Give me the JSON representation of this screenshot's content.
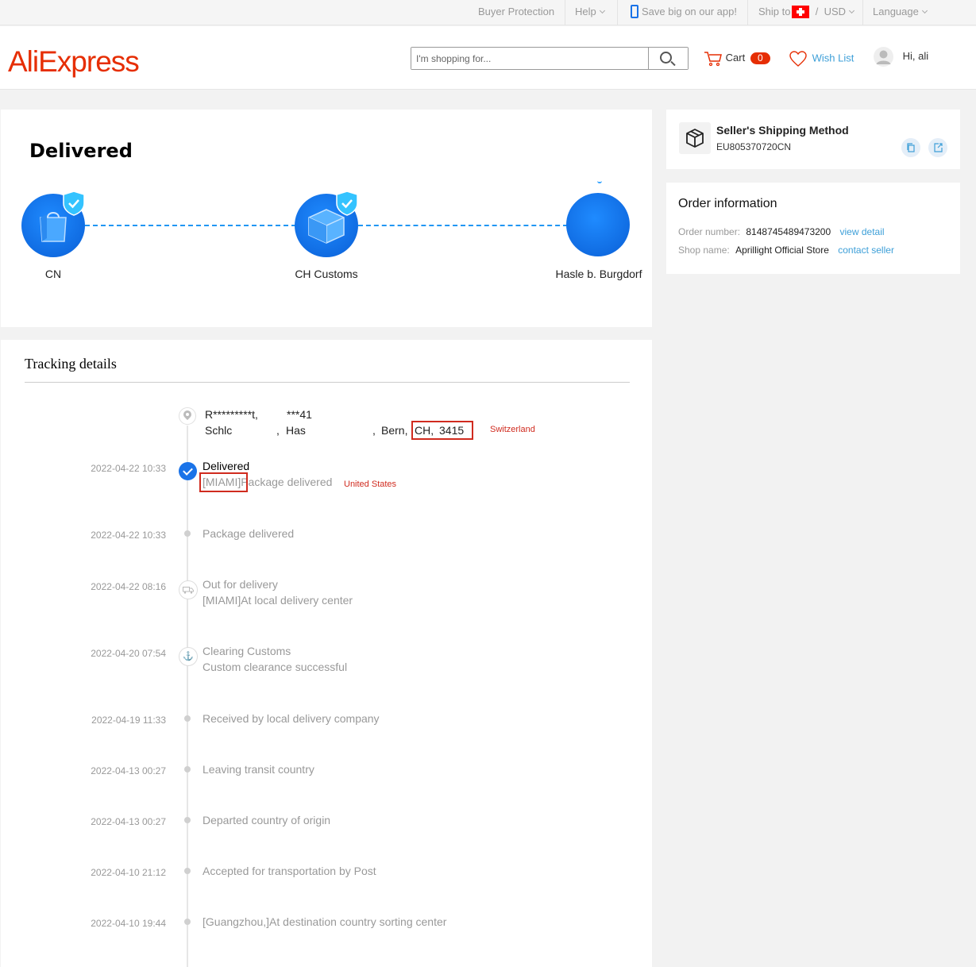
{
  "topbar": {
    "buyer_protection": "Buyer Protection",
    "help": "Help",
    "app_promo": "Save big on our app!",
    "ship_to": "Ship to",
    "currency_sep": "/",
    "currency": "USD",
    "language": "Language"
  },
  "header": {
    "logo": "AliExpress",
    "search_placeholder": "I'm shopping for...",
    "cart_label": "Cart",
    "cart_count": "0",
    "wishlist_label": "Wish List",
    "greeting": "Hi, ali"
  },
  "status": {
    "title": "Delivered",
    "nodes": [
      {
        "label": "CN",
        "icon": "shopping-bag-icon",
        "verified": true
      },
      {
        "label": "CH Customs",
        "icon": "customs-package-icon",
        "verified": true
      },
      {
        "label": "Hasle b. Burgdorf",
        "icon": "destination-icon",
        "verified": false
      }
    ]
  },
  "tracking": {
    "title": "Tracking details",
    "address_line1_name": "R*********t,",
    "address_line1_phone": "***41",
    "address_line2_street": "Schlc",
    "address_line2_sep1": ",",
    "address_line2_town": "Has",
    "address_line2_sep2": ",",
    "address_line2_city": "Bern,",
    "address_line2_country": "CH,",
    "address_line2_zip": "3415",
    "annotation_country": "Switzerland",
    "annotation_origin": "United States",
    "events": [
      {
        "time": "2022-04-22 10:33",
        "title": "Delivered",
        "subtitle": "[MIAMI]Package delivered",
        "marker": "check"
      },
      {
        "time": "2022-04-22 10:33",
        "title": "Package delivered",
        "subtitle": "",
        "marker": "dot"
      },
      {
        "time": "2022-04-22 08:16",
        "title": "Out for delivery",
        "subtitle": "[MIAMI]At local delivery center",
        "marker": "truck-icon"
      },
      {
        "time": "2022-04-20 07:54",
        "title": "Clearing Customs",
        "subtitle": "Custom clearance successful",
        "marker": "anchor-icon"
      },
      {
        "time": "2022-04-19 11:33",
        "title": "Received by local delivery company",
        "subtitle": "",
        "marker": "dot"
      },
      {
        "time": "2022-04-13 00:27",
        "title": "Leaving transit country",
        "subtitle": "",
        "marker": "dot"
      },
      {
        "time": "2022-04-13 00:27",
        "title": "Departed country of origin",
        "subtitle": "",
        "marker": "dot"
      },
      {
        "time": "2022-04-10 21:12",
        "title": "Accepted for transportation by Post",
        "subtitle": "",
        "marker": "dot"
      },
      {
        "time": "2022-04-10 19:44",
        "title": "[Guangzhou,]At destination country sorting center",
        "subtitle": "",
        "marker": "dot"
      }
    ]
  },
  "shipping": {
    "title": "Seller's Shipping Method",
    "tracking_number": "EU805370720CN"
  },
  "order": {
    "title": "Order information",
    "number_label": "Order number:",
    "number_value": "8148745489473200",
    "view_detail": "view detail",
    "shop_label": "Shop name:",
    "shop_value": "Aprillight Official Store",
    "contact_seller": "contact seller"
  },
  "colors": {
    "brand": "#e62e04",
    "accent_blue": "#1a73e8",
    "link": "#3d9fd8",
    "annotation_red": "#d02b1f"
  }
}
